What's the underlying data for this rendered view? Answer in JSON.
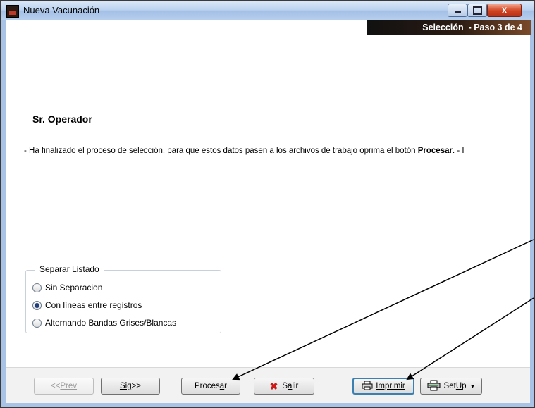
{
  "window": {
    "title": "Nueva Vacunación",
    "controls": {
      "minimize": "–",
      "maximize": "□",
      "close": "X"
    }
  },
  "step_banner": {
    "label": "Selección",
    "step": "- Paso 3 de 4"
  },
  "heading": "Sr. Operador",
  "message": {
    "before": "- Ha finalizado el proceso de selección, para que estos datos pasen a los archivos de trabajo   oprima el botón ",
    "emphasis": "Procesar",
    "after": ". - I"
  },
  "separar_listado": {
    "label": "Separar Listado",
    "options": [
      {
        "label": "Sin Separacion",
        "selected": false
      },
      {
        "label": "Con líneas entre registros",
        "selected": true
      },
      {
        "label": "Alternando Bandas Grises/Blancas",
        "selected": false
      }
    ]
  },
  "buttons": {
    "prev": {
      "prefix": "<< ",
      "label": "Prev"
    },
    "sig": {
      "label": "Sig",
      "suffix": " >>"
    },
    "procesar": {
      "pre": "Proces",
      "u": "a",
      "post": "r"
    },
    "salir": {
      "pre": "S",
      "u": "a",
      "post": "lir"
    },
    "imprimir": {
      "label": "Imprimir"
    },
    "setup": {
      "pre": "Set",
      "u": "U",
      "post": "p"
    }
  },
  "icons": {
    "app": "syringe-app-icon",
    "salir": "red-x-icon",
    "imprimir": "printer-icon",
    "setup": "printer-setup-icon",
    "setup_caret": "▼"
  },
  "colors": {
    "banner_start": "#111111",
    "banner_end": "#7a4a2a",
    "titlebar": "#bcd3ef",
    "arrow": "#000000"
  }
}
